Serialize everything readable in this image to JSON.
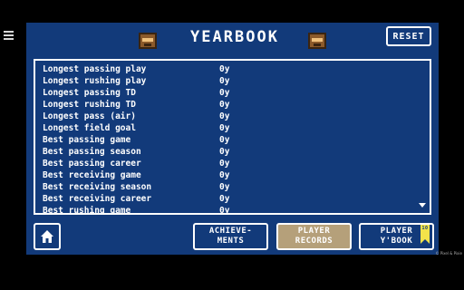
{
  "header": {
    "title": "YEARBOOK",
    "reset_label": "RESET"
  },
  "stats": [
    {
      "label": "Longest passing play",
      "value": "0y"
    },
    {
      "label": "Longest rushing play",
      "value": "0y"
    },
    {
      "label": "Longest passing TD",
      "value": "0y"
    },
    {
      "label": "Longest rushing TD",
      "value": "0y"
    },
    {
      "label": "Longest pass (air)",
      "value": "0y"
    },
    {
      "label": "Longest field goal",
      "value": "0y"
    },
    {
      "label": "Best passing game",
      "value": "0y"
    },
    {
      "label": "Best passing season",
      "value": "0y"
    },
    {
      "label": "Best passing career",
      "value": "0y"
    },
    {
      "label": "Best receiving game",
      "value": "0y"
    },
    {
      "label": "Best receiving season",
      "value": "0y"
    },
    {
      "label": "Best receiving career",
      "value": "0y"
    },
    {
      "label": "Best rushing game",
      "value": "0y"
    }
  ],
  "nav": {
    "achievements_line1": "ACHIEVE-",
    "achievements_line2": "MENTS",
    "records_line1": "PLAYER",
    "records_line2": "RECORDS",
    "ybook_line1": "PLAYER",
    "ybook_line2": "Y'BOOK",
    "ybook_badge": "10"
  },
  "credit": "© Pixel & Pixie",
  "colors": {
    "panel": "#123a7a",
    "records_button": "#b5a07a",
    "badge": "#f2e34a"
  }
}
